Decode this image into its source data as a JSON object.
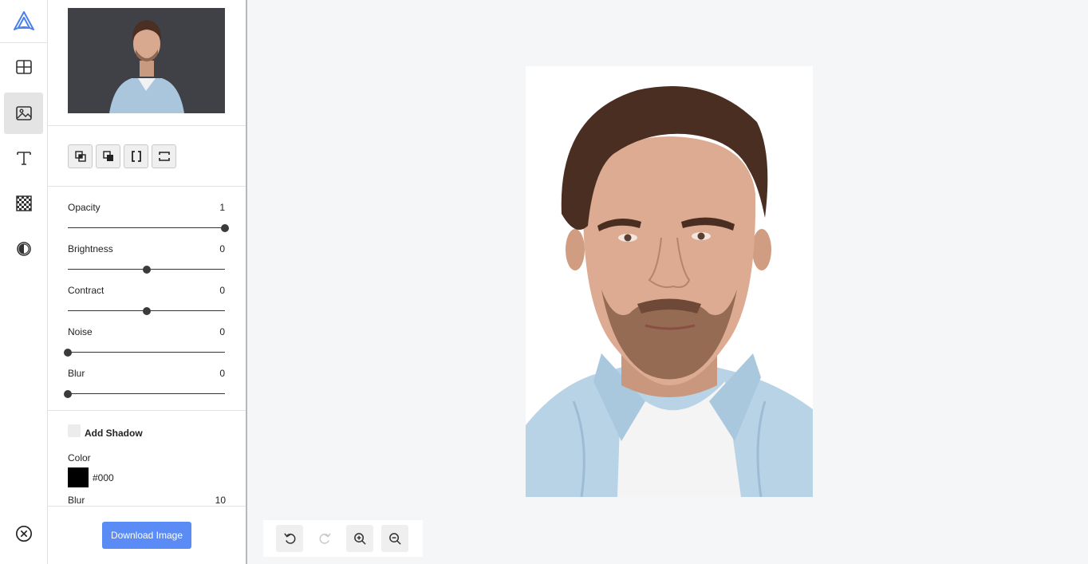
{
  "rail": {
    "logo": "logo-icon",
    "tools": [
      {
        "name": "templates",
        "icon": "grid-icon",
        "active": false
      },
      {
        "name": "image",
        "icon": "image-icon",
        "active": true
      },
      {
        "name": "text",
        "icon": "text-icon",
        "active": false
      },
      {
        "name": "background",
        "icon": "checkerboard-icon",
        "active": false
      },
      {
        "name": "filters",
        "icon": "contrast-icon",
        "active": false
      }
    ],
    "close": "close-icon"
  },
  "panel": {
    "layer_buttons": [
      "bring-forward-icon",
      "send-backward-icon",
      "flip-horizontal-icon",
      "flip-vertical-icon"
    ],
    "sliders": [
      {
        "label": "Opacity",
        "value": "1",
        "level": 1.0
      },
      {
        "label": "Brightness",
        "value": "0",
        "level": 0.5
      },
      {
        "label": "Contract",
        "value": "0",
        "level": 0.5
      },
      {
        "label": "Noise",
        "value": "0",
        "level": 0.0
      },
      {
        "label": "Blur",
        "value": "0",
        "level": 0.0
      }
    ],
    "shadow": {
      "toggle_label": "Add Shadow",
      "color_label": "Color",
      "color_value": "#000",
      "cut_label": "Blur",
      "cut_value": "10"
    },
    "download_label": "Download Image"
  },
  "toolbar": {
    "buttons": [
      "undo-icon",
      "redo-icon",
      "zoom-in-icon",
      "zoom-out-icon"
    ]
  },
  "colors": {
    "accent": "#5b8cf5",
    "shadow": "#000000"
  }
}
